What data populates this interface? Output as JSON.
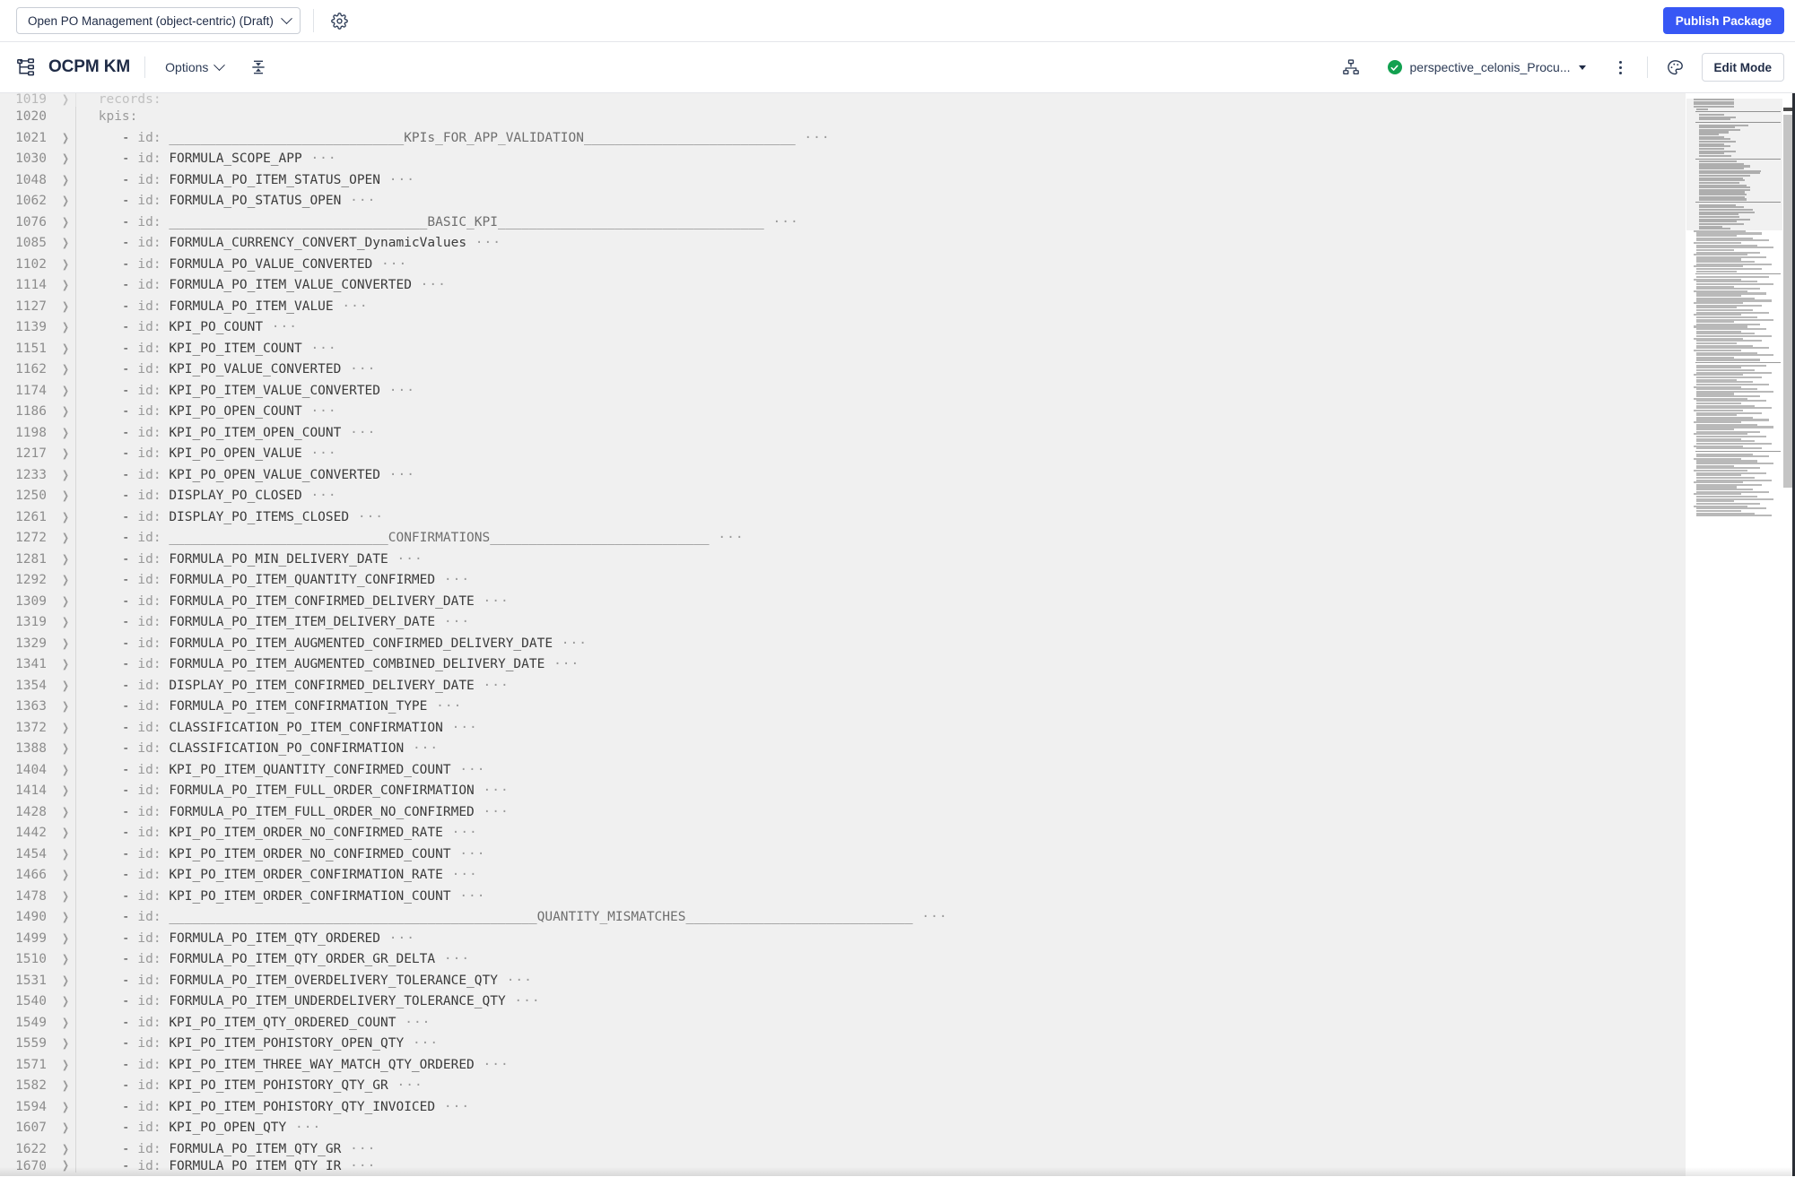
{
  "topbar": {
    "package_selector": "Open PO Management (object-centric) (Draft)",
    "settings_icon": "gear-icon",
    "publish_label": "Publish Package"
  },
  "subbar": {
    "logo_icon": "hierarchy-tree-icon",
    "app_title": "OCPM KM",
    "options_label": "Options",
    "collapse_all_icon": "collapse-all-icon",
    "structure_icon": "org-chart-icon",
    "perspective_label": "perspective_celonis_Procu...",
    "perspective_status": "valid",
    "more_icon": "kebab-menu-icon",
    "theme_icon": "palette-icon",
    "edit_mode_label": "Edit Mode"
  },
  "editor": {
    "language": "yaml",
    "partial_top_line": {
      "num": "1019",
      "text": "records:"
    },
    "partial_bottom_line": {
      "num": "1670",
      "prefix": "- id: ",
      "value": "FORMULA_PO_ITEM_QTY_IR",
      "ellipsis": true
    },
    "lines": [
      {
        "num": "1020",
        "fold": false,
        "indent": 1,
        "raw": "kpis:",
        "kind": "key"
      },
      {
        "num": "1021",
        "fold": true,
        "indent": 2,
        "prefix": "- id: ",
        "value": "______________________________KPIs_FOR_APP_VALIDATION___________________________",
        "ellipsis": true,
        "kind": "rule"
      },
      {
        "num": "1030",
        "fold": true,
        "indent": 2,
        "prefix": "- id: ",
        "value": "FORMULA_SCOPE_APP",
        "ellipsis": true,
        "kind": "val"
      },
      {
        "num": "1048",
        "fold": true,
        "indent": 2,
        "prefix": "- id: ",
        "value": "FORMULA_PO_ITEM_STATUS_OPEN",
        "ellipsis": true,
        "kind": "val"
      },
      {
        "num": "1062",
        "fold": true,
        "indent": 2,
        "prefix": "- id: ",
        "value": "FORMULA_PO_STATUS_OPEN",
        "ellipsis": true,
        "kind": "val"
      },
      {
        "num": "1076",
        "fold": true,
        "indent": 2,
        "prefix": "- id: ",
        "value": "_________________________________BASIC_KPI__________________________________",
        "ellipsis": true,
        "kind": "rule"
      },
      {
        "num": "1085",
        "fold": true,
        "indent": 2,
        "prefix": "- id: ",
        "value": "FORMULA_CURRENCY_CONVERT_DynamicValues",
        "ellipsis": true,
        "kind": "val"
      },
      {
        "num": "1102",
        "fold": true,
        "indent": 2,
        "prefix": "- id: ",
        "value": "FORMULA_PO_VALUE_CONVERTED",
        "ellipsis": true,
        "kind": "val"
      },
      {
        "num": "1114",
        "fold": true,
        "indent": 2,
        "prefix": "- id: ",
        "value": "FORMULA_PO_ITEM_VALUE_CONVERTED",
        "ellipsis": true,
        "kind": "val"
      },
      {
        "num": "1127",
        "fold": true,
        "indent": 2,
        "prefix": "- id: ",
        "value": "FORMULA_PO_ITEM_VALUE",
        "ellipsis": true,
        "kind": "val"
      },
      {
        "num": "1139",
        "fold": true,
        "indent": 2,
        "prefix": "- id: ",
        "value": "KPI_PO_COUNT",
        "ellipsis": true,
        "kind": "val"
      },
      {
        "num": "1151",
        "fold": true,
        "indent": 2,
        "prefix": "- id: ",
        "value": "KPI_PO_ITEM_COUNT",
        "ellipsis": true,
        "kind": "val"
      },
      {
        "num": "1162",
        "fold": true,
        "indent": 2,
        "prefix": "- id: ",
        "value": "KPI_PO_VALUE_CONVERTED",
        "ellipsis": true,
        "kind": "val"
      },
      {
        "num": "1174",
        "fold": true,
        "indent": 2,
        "prefix": "- id: ",
        "value": "KPI_PO_ITEM_VALUE_CONVERTED",
        "ellipsis": true,
        "kind": "val"
      },
      {
        "num": "1186",
        "fold": true,
        "indent": 2,
        "prefix": "- id: ",
        "value": "KPI_PO_OPEN_COUNT",
        "ellipsis": true,
        "kind": "val"
      },
      {
        "num": "1198",
        "fold": true,
        "indent": 2,
        "prefix": "- id: ",
        "value": "KPI_PO_ITEM_OPEN_COUNT",
        "ellipsis": true,
        "kind": "val"
      },
      {
        "num": "1217",
        "fold": true,
        "indent": 2,
        "prefix": "- id: ",
        "value": "KPI_PO_OPEN_VALUE",
        "ellipsis": true,
        "kind": "val"
      },
      {
        "num": "1233",
        "fold": true,
        "indent": 2,
        "prefix": "- id: ",
        "value": "KPI_PO_OPEN_VALUE_CONVERTED",
        "ellipsis": true,
        "kind": "val"
      },
      {
        "num": "1250",
        "fold": true,
        "indent": 2,
        "prefix": "- id: ",
        "value": "DISPLAY_PO_CLOSED",
        "ellipsis": true,
        "kind": "val"
      },
      {
        "num": "1261",
        "fold": true,
        "indent": 2,
        "prefix": "- id: ",
        "value": "DISPLAY_PO_ITEMS_CLOSED",
        "ellipsis": true,
        "kind": "val"
      },
      {
        "num": "1272",
        "fold": true,
        "indent": 2,
        "prefix": "- id: ",
        "value": "____________________________CONFIRMATIONS____________________________",
        "ellipsis": true,
        "kind": "rule"
      },
      {
        "num": "1281",
        "fold": true,
        "indent": 2,
        "prefix": "- id: ",
        "value": "FORMULA_PO_MIN_DELIVERY_DATE",
        "ellipsis": true,
        "kind": "val"
      },
      {
        "num": "1292",
        "fold": true,
        "indent": 2,
        "prefix": "- id: ",
        "value": "FORMULA_PO_ITEM_QUANTITY_CONFIRMED",
        "ellipsis": true,
        "kind": "val"
      },
      {
        "num": "1309",
        "fold": true,
        "indent": 2,
        "prefix": "- id: ",
        "value": "FORMULA_PO_ITEM_CONFIRMED_DELIVERY_DATE",
        "ellipsis": true,
        "kind": "val"
      },
      {
        "num": "1319",
        "fold": true,
        "indent": 2,
        "prefix": "- id: ",
        "value": "FORMULA_PO_ITEM_ITEM_DELIVERY_DATE",
        "ellipsis": true,
        "kind": "val"
      },
      {
        "num": "1329",
        "fold": true,
        "indent": 2,
        "prefix": "- id: ",
        "value": "FORMULA_PO_ITEM_AUGMENTED_CONFIRMED_DELIVERY_DATE",
        "ellipsis": true,
        "kind": "val"
      },
      {
        "num": "1341",
        "fold": true,
        "indent": 2,
        "prefix": "- id: ",
        "value": "FORMULA_PO_ITEM_AUGMENTED_COMBINED_DELIVERY_DATE",
        "ellipsis": true,
        "kind": "val"
      },
      {
        "num": "1354",
        "fold": true,
        "indent": 2,
        "prefix": "- id: ",
        "value": "DISPLAY_PO_ITEM_CONFIRMED_DELIVERY_DATE",
        "ellipsis": true,
        "kind": "val"
      },
      {
        "num": "1363",
        "fold": true,
        "indent": 2,
        "prefix": "- id: ",
        "value": "FORMULA_PO_ITEM_CONFIRMATION_TYPE",
        "ellipsis": true,
        "kind": "val"
      },
      {
        "num": "1372",
        "fold": true,
        "indent": 2,
        "prefix": "- id: ",
        "value": "CLASSIFICATION_PO_ITEM_CONFIRMATION",
        "ellipsis": true,
        "kind": "val"
      },
      {
        "num": "1388",
        "fold": true,
        "indent": 2,
        "prefix": "- id: ",
        "value": "CLASSIFICATION_PO_CONFIRMATION",
        "ellipsis": true,
        "kind": "val"
      },
      {
        "num": "1404",
        "fold": true,
        "indent": 2,
        "prefix": "- id: ",
        "value": "KPI_PO_ITEM_QUANTITY_CONFIRMED_COUNT",
        "ellipsis": true,
        "kind": "val"
      },
      {
        "num": "1414",
        "fold": true,
        "indent": 2,
        "prefix": "- id: ",
        "value": "FORMULA_PO_ITEM_FULL_ORDER_CONFIRMATION",
        "ellipsis": true,
        "kind": "val"
      },
      {
        "num": "1428",
        "fold": true,
        "indent": 2,
        "prefix": "- id: ",
        "value": "FORMULA_PO_ITEM_FULL_ORDER_NO_CONFIRMED",
        "ellipsis": true,
        "kind": "val"
      },
      {
        "num": "1442",
        "fold": true,
        "indent": 2,
        "prefix": "- id: ",
        "value": "KPI_PO_ITEM_ORDER_NO_CONFIRMED_RATE",
        "ellipsis": true,
        "kind": "val"
      },
      {
        "num": "1454",
        "fold": true,
        "indent": 2,
        "prefix": "- id: ",
        "value": "KPI_PO_ITEM_ORDER_NO_CONFIRMED_COUNT",
        "ellipsis": true,
        "kind": "val"
      },
      {
        "num": "1466",
        "fold": true,
        "indent": 2,
        "prefix": "- id: ",
        "value": "KPI_PO_ITEM_ORDER_CONFIRMATION_RATE",
        "ellipsis": true,
        "kind": "val"
      },
      {
        "num": "1478",
        "fold": true,
        "indent": 2,
        "prefix": "- id: ",
        "value": "KPI_PO_ITEM_ORDER_CONFIRMATION_COUNT",
        "ellipsis": true,
        "kind": "val"
      },
      {
        "num": "1490",
        "fold": true,
        "indent": 2,
        "prefix": "- id: ",
        "value": "_______________________________________________QUANTITY_MISMATCHES_____________________________",
        "ellipsis": true,
        "kind": "rule"
      },
      {
        "num": "1499",
        "fold": true,
        "indent": 2,
        "prefix": "- id: ",
        "value": "FORMULA_PO_ITEM_QTY_ORDERED",
        "ellipsis": true,
        "kind": "val"
      },
      {
        "num": "1510",
        "fold": true,
        "indent": 2,
        "prefix": "- id: ",
        "value": "FORMULA_PO_ITEM_QTY_ORDER_GR_DELTA",
        "ellipsis": true,
        "kind": "val"
      },
      {
        "num": "1531",
        "fold": true,
        "indent": 2,
        "prefix": "- id: ",
        "value": "FORMULA_PO_ITEM_OVERDELIVERY_TOLERANCE_QTY",
        "ellipsis": true,
        "kind": "val"
      },
      {
        "num": "1540",
        "fold": true,
        "indent": 2,
        "prefix": "- id: ",
        "value": "FORMULA_PO_ITEM_UNDERDELIVERY_TOLERANCE_QTY",
        "ellipsis": true,
        "kind": "val"
      },
      {
        "num": "1549",
        "fold": true,
        "indent": 2,
        "prefix": "- id: ",
        "value": "KPI_PO_ITEM_QTY_ORDERED_COUNT",
        "ellipsis": true,
        "kind": "val"
      },
      {
        "num": "1559",
        "fold": true,
        "indent": 2,
        "prefix": "- id: ",
        "value": "KPI_PO_ITEM_POHISTORY_OPEN_QTY",
        "ellipsis": true,
        "kind": "val"
      },
      {
        "num": "1571",
        "fold": true,
        "indent": 2,
        "prefix": "- id: ",
        "value": "KPI_PO_ITEM_THREE_WAY_MATCH_QTY_ORDERED",
        "ellipsis": true,
        "kind": "val"
      },
      {
        "num": "1582",
        "fold": true,
        "indent": 2,
        "prefix": "- id: ",
        "value": "KPI_PO_ITEM_POHISTORY_QTY_GR",
        "ellipsis": true,
        "kind": "val"
      },
      {
        "num": "1594",
        "fold": true,
        "indent": 2,
        "prefix": "- id: ",
        "value": "KPI_PO_ITEM_POHISTORY_QTY_INVOICED",
        "ellipsis": true,
        "kind": "val"
      },
      {
        "num": "1607",
        "fold": true,
        "indent": 2,
        "prefix": "- id: ",
        "value": "KPI_PO_OPEN_QTY",
        "ellipsis": true,
        "kind": "val"
      },
      {
        "num": "1622",
        "fold": true,
        "indent": 2,
        "prefix": "- id: ",
        "value": "FORMULA_PO_ITEM_QTY_GR",
        "ellipsis": true,
        "kind": "val"
      }
    ]
  },
  "colors": {
    "accent": "#3757f5",
    "editor_bg": "#f0f0f0",
    "gutter_text": "#8d8d8d",
    "code_text": "#3b3b3b",
    "key_text": "#9a9a9a",
    "status_green": "#12a150",
    "header_text": "#1f2b46"
  }
}
